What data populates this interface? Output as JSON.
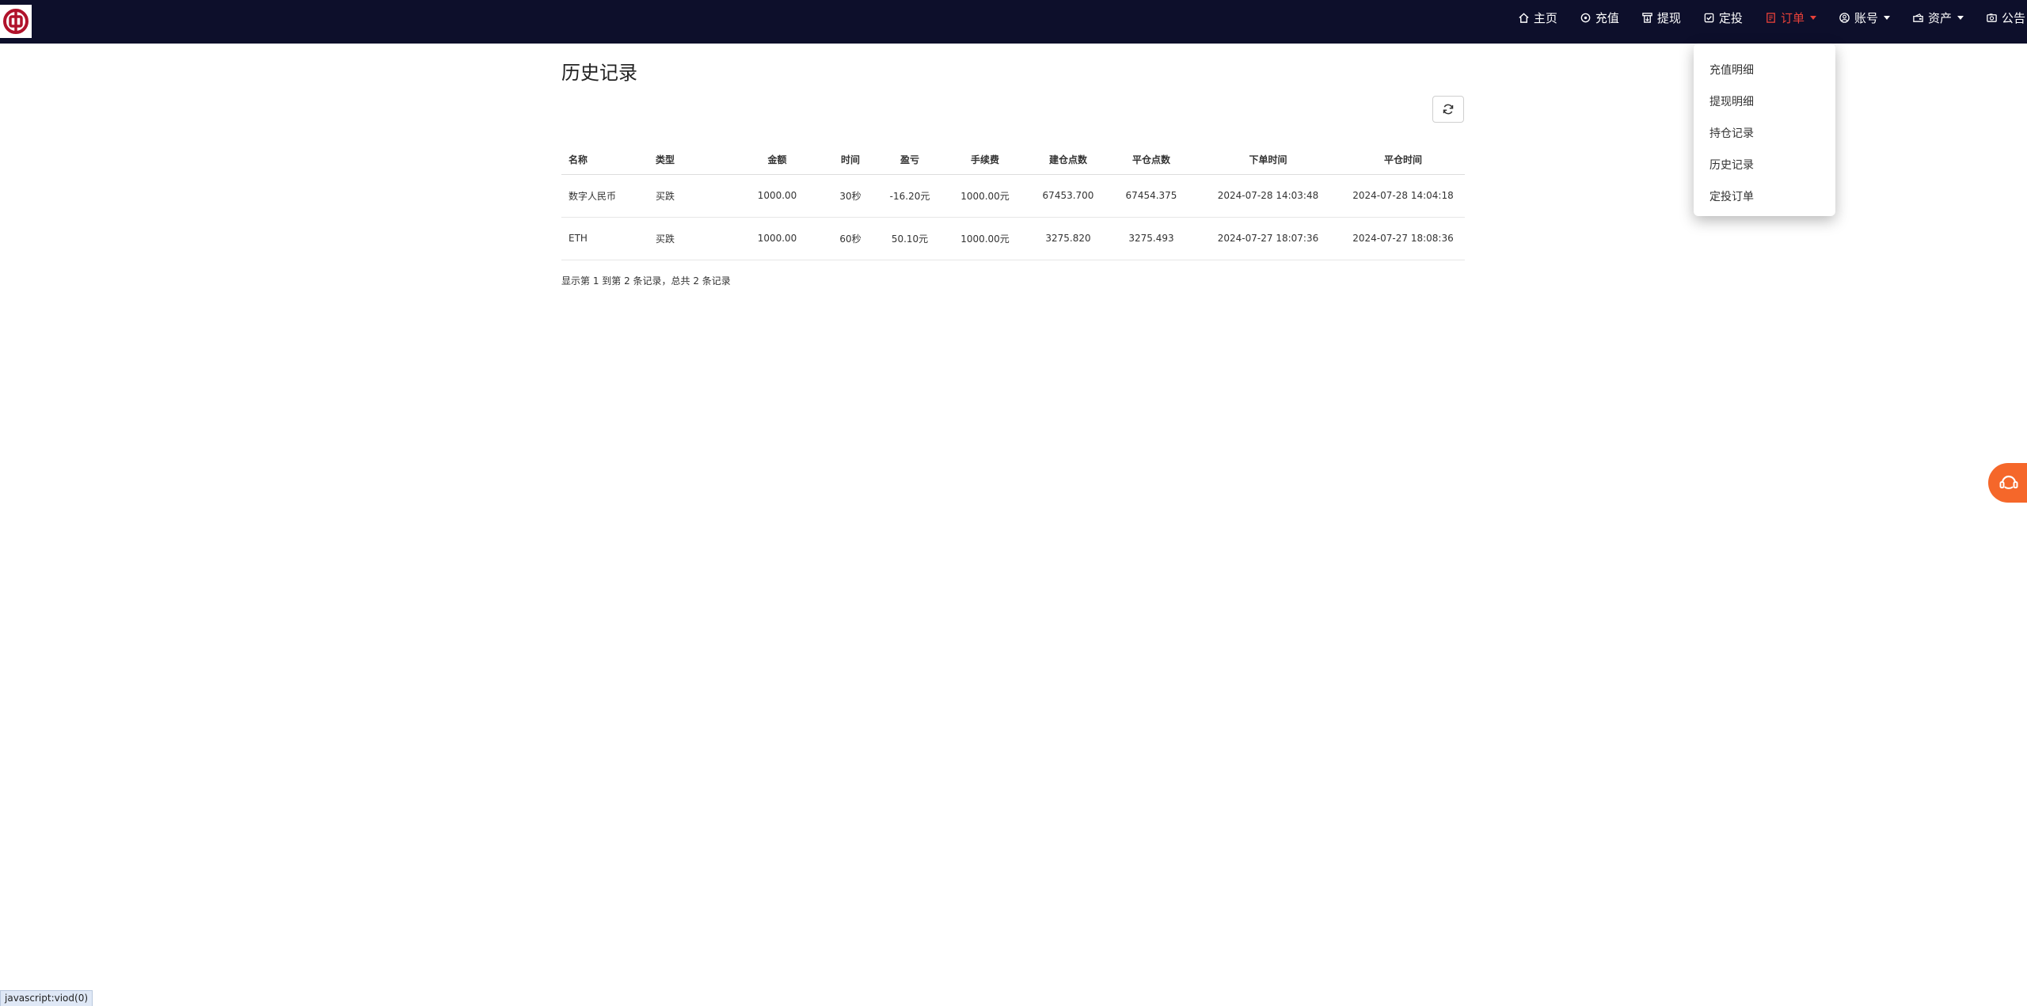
{
  "nav": {
    "items": [
      {
        "label": "主页",
        "icon": "home-icon"
      },
      {
        "label": "充值",
        "icon": "deposit-icon"
      },
      {
        "label": "提现",
        "icon": "withdraw-icon"
      },
      {
        "label": "定投",
        "icon": "checkbox-icon"
      },
      {
        "label": "订单",
        "icon": "order-icon",
        "active": true
      },
      {
        "label": "账号",
        "icon": "user-icon"
      },
      {
        "label": "资产",
        "icon": "wallet-icon"
      },
      {
        "label": "公告",
        "icon": "notice-icon"
      }
    ],
    "active_color": "#e8413a",
    "background": "#0d0f2b"
  },
  "dropdown": {
    "items": [
      "充值明细",
      "提现明细",
      "持仓记录",
      "历史记录",
      "定投订单"
    ]
  },
  "page": {
    "title": "历史记录"
  },
  "table": {
    "headers": [
      "名称",
      "类型",
      "金额",
      "时间",
      "盈亏",
      "手续费",
      "建仓点数",
      "平仓点数",
      "下单时间",
      "平仓时间"
    ],
    "rows": [
      [
        "数字人民币",
        "买跌",
        "1000.00",
        "30秒",
        "-16.20元",
        "1000.00元",
        "67453.700",
        "67454.375",
        "2024-07-28 14:03:48",
        "2024-07-28 14:04:18"
      ],
      [
        "ETH",
        "买跌",
        "1000.00",
        "60秒",
        "50.10元",
        "1000.00元",
        "3275.820",
        "3275.493",
        "2024-07-27 18:07:36",
        "2024-07-27 18:08:36"
      ]
    ]
  },
  "pagination": {
    "info": "显示第 1 到第 2 条记录，总共 2 条记录"
  },
  "status_bar": {
    "text": "javascript:viod(0)"
  },
  "support": {
    "icon": "customer-service-icon",
    "color": "#f5672a"
  }
}
